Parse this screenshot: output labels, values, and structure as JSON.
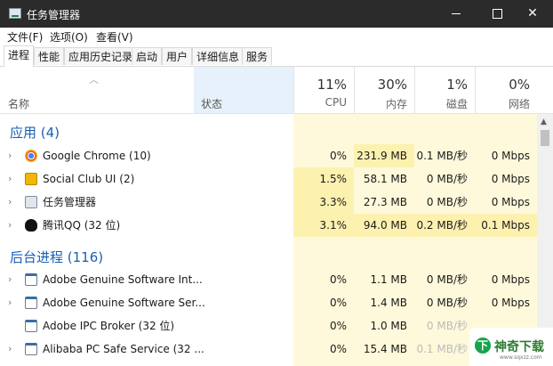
{
  "window": {
    "title": "任务管理器"
  },
  "menu": [
    "文件(F)",
    "选项(O)",
    "查看(V)"
  ],
  "tabs": [
    "进程",
    "性能",
    "应用历史记录",
    "启动",
    "用户",
    "详细信息",
    "服务"
  ],
  "header": {
    "name": "名称",
    "status": "状态",
    "cpu": {
      "pct": "11%",
      "label": "CPU"
    },
    "mem": {
      "pct": "30%",
      "label": "内存"
    },
    "disk": {
      "pct": "1%",
      "label": "磁盘"
    },
    "net": {
      "pct": "0%",
      "label": "网络"
    }
  },
  "groups": [
    {
      "title": "应用 (4)"
    },
    {
      "title": "后台进程 (116)"
    }
  ],
  "rows": [
    {
      "name": "Google Chrome (10)",
      "cpu": "0%",
      "mem": "231.9 MB",
      "disk": "0.1 MB/秒",
      "net": "0 Mbps",
      "icon": "chrome-icon"
    },
    {
      "name": "Social Club UI (2)",
      "cpu": "1.5%",
      "mem": "58.1 MB",
      "disk": "0 MB/秒",
      "net": "0 Mbps",
      "icon": "social-club-icon"
    },
    {
      "name": "任务管理器",
      "cpu": "3.3%",
      "mem": "27.3 MB",
      "disk": "0 MB/秒",
      "net": "0 Mbps",
      "icon": "task-manager-icon"
    },
    {
      "name": "腾讯QQ (32 位)",
      "cpu": "3.1%",
      "mem": "94.0 MB",
      "disk": "0.2 MB/秒",
      "net": "0.1 Mbps",
      "icon": "qq-penguin-icon"
    },
    {
      "name": "Adobe Genuine Software Int...",
      "cpu": "0%",
      "mem": "1.1 MB",
      "disk": "0 MB/秒",
      "net": "0 Mbps",
      "icon": "service-window-icon"
    },
    {
      "name": "Adobe Genuine Software Ser...",
      "cpu": "0%",
      "mem": "1.4 MB",
      "disk": "0 MB/秒",
      "net": "0 Mbps",
      "icon": "service-window-icon"
    },
    {
      "name": "Adobe IPC Broker (32 位)",
      "cpu": "0%",
      "mem": "1.0 MB",
      "disk": "0 MB/秒",
      "net": "",
      "icon": "service-window-icon"
    },
    {
      "name": "Alibaba PC Safe Service (32 ...",
      "cpu": "0%",
      "mem": "15.4 MB",
      "disk": "0.1 MB/秒",
      "net": "",
      "icon": "service-window-icon"
    }
  ],
  "watermark": {
    "text": "神奇下载",
    "url": "www.sqxzz.com",
    "logo": "下"
  },
  "colors": {
    "titlebar": "#2b2b2b",
    "accent": "#1a5fb4",
    "heat_light": "#fff9db",
    "heat_mid": "#fdf1b0",
    "status_col": "#e6f1fb"
  }
}
